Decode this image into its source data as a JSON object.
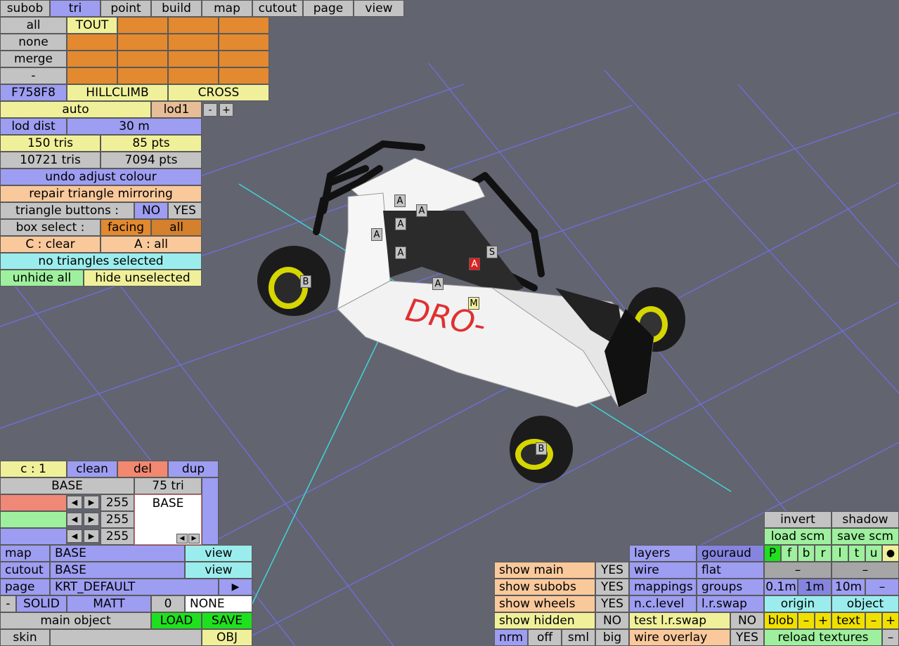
{
  "menu": [
    "subob",
    "tri",
    "point",
    "build",
    "map",
    "cutout",
    "page",
    "view"
  ],
  "sel": {
    "all": "all",
    "none": "none",
    "merge": "merge",
    "minus": "-",
    "tout": "TOUT"
  },
  "colours": {
    "code": "F758F8",
    "hillclimb": "HILLCLIMB",
    "cross": "CROSS"
  },
  "lod": {
    "auto": "auto",
    "lod1": "lod1",
    "minus": "-",
    "plus": "+",
    "dist_label": "lod dist",
    "dist_value": "30 m"
  },
  "stats": {
    "tris": "150 tris",
    "pts": "85 pts",
    "total_tris": "10721 tris",
    "total_pts": "7094 pts"
  },
  "actions": {
    "undo": "undo adjust colour",
    "repair": "repair triangle mirroring",
    "tri_buttons": "triangle buttons :",
    "no": "NO",
    "yes": "YES",
    "box_select": "box select :",
    "facing": "facing",
    "all": "all",
    "c_clear": "C : clear",
    "a_all": "A : all",
    "status": "no triangles selected",
    "unhide": "unhide all",
    "hide_unsel": "hide unselected"
  },
  "subob": {
    "count": "c : 1",
    "clean": "clean",
    "del": "del",
    "dup": "dup",
    "name": "BASE",
    "tris": "75 tri",
    "list_item": "BASE",
    "r": "255",
    "g": "255",
    "b": "255"
  },
  "mat": {
    "map_label": "map",
    "map_value": "BASE",
    "view": "view",
    "cutout_label": "cutout",
    "cutout_value": "BASE",
    "page_label": "page",
    "page_value": "KRT_DEFAULT",
    "arrow": "▶",
    "minus": "-",
    "solid": "SOLID",
    "matt": "MATT",
    "zero": "0",
    "none": "NONE",
    "main_object": "main object",
    "load": "LOAD",
    "save": "SAVE",
    "skin": "skin",
    "obj": "OBJ"
  },
  "show": {
    "main": "show main",
    "subobs": "show subobs",
    "wheels": "show wheels",
    "hidden": "show hidden",
    "yes": "YES",
    "no": "NO",
    "nrm": "nrm",
    "off": "off",
    "sml": "sml",
    "big": "big"
  },
  "render": {
    "layers": "layers",
    "gouraud": "gouraud",
    "wire": "wire",
    "flat": "flat",
    "mappings": "mappings",
    "groups": "groups",
    "nclevel": "n.c.level",
    "lrswap": "l.r.swap",
    "test_lrswap": "test l.r.swap",
    "no": "NO",
    "wire_overlay": "wire overlay",
    "yes": "YES"
  },
  "view": {
    "invert": "invert",
    "shadow": "shadow",
    "load_scm": "load scm",
    "save_scm": "save scm",
    "axes": [
      "P",
      "f",
      "b",
      "r",
      "l",
      "t",
      "u",
      "●"
    ],
    "dash": "–",
    "m01": "0.1m",
    "m1": "1m",
    "m10": "10m",
    "minus": "–",
    "origin": "origin",
    "object": "object",
    "blob": "blob",
    "text": "text",
    "minus2": "–",
    "plus": "+",
    "reload": "reload textures"
  },
  "markers": [
    "A",
    "A",
    "A",
    "A",
    "A",
    "A",
    "A",
    "A",
    "S",
    "M",
    "B",
    "B"
  ],
  "car_text": "DRO-"
}
